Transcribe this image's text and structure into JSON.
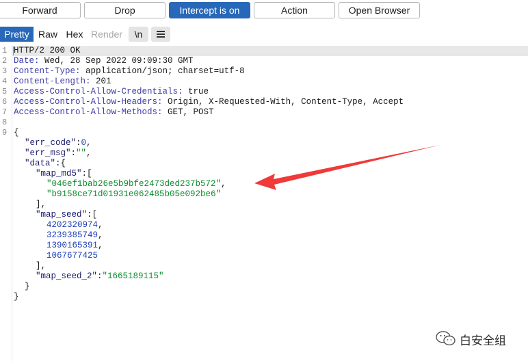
{
  "toolbar": {
    "buttons": [
      {
        "label": "Forward"
      },
      {
        "label": "Drop"
      },
      {
        "label": "Intercept is on"
      },
      {
        "label": "Action"
      },
      {
        "label": "Open Browser"
      }
    ]
  },
  "view_tabs": {
    "pretty": "Pretty",
    "raw": "Raw",
    "hex": "Hex",
    "render": "Render",
    "newline": "\\n",
    "menu_icon": "hamburger-menu-icon"
  },
  "editor": {
    "line_numbers": [
      "1",
      "2",
      "3",
      "4",
      "5",
      "6",
      "7",
      "8",
      "9"
    ],
    "headers": {
      "status_line": "HTTP/2 200 OK",
      "date_name": "Date:",
      "date_value": " Wed, 28 Sep 2022 09:09:30 GMT",
      "ctype_name": "Content-Type:",
      "ctype_value": " application/json; charset=utf-8",
      "clen_name": "Content-Length:",
      "clen_value": " 201",
      "acac_name": "Access-Control-Allow-Credentials:",
      "acac_value": " true",
      "acah_name": "Access-Control-Allow-Headers:",
      "acah_value": " Origin, X-Requested-With, Content-Type, Accept",
      "acam_name": "Access-Control-Allow-Methods:",
      "acam_value": " GET, POST"
    },
    "body": {
      "open_brace": "{",
      "err_code_key": "\"err_code\"",
      "err_code_value": "0",
      "err_msg_key": "\"err_msg\"",
      "err_msg_value": "\"\"",
      "data_key": "\"data\"",
      "map_md5_key": "\"map_md5\"",
      "map_md5_values": [
        "\"046ef1bab26e5b9bfe2473ded237b572\"",
        "\"b9158ce71d01931e062485b05e092be6\""
      ],
      "map_seed_key": "\"map_seed\"",
      "map_seed_values": [
        "4202320974",
        "3239385749",
        "1390165391",
        "1067677425"
      ],
      "map_seed_2_key": "\"map_seed_2\"",
      "map_seed_2_value": "\"1665189115\"",
      "close_brace": "}"
    }
  },
  "annotation": {
    "arrow_color": "#f03a3a"
  },
  "watermark": {
    "text": "白安全组",
    "icon": "wechat-icon"
  }
}
